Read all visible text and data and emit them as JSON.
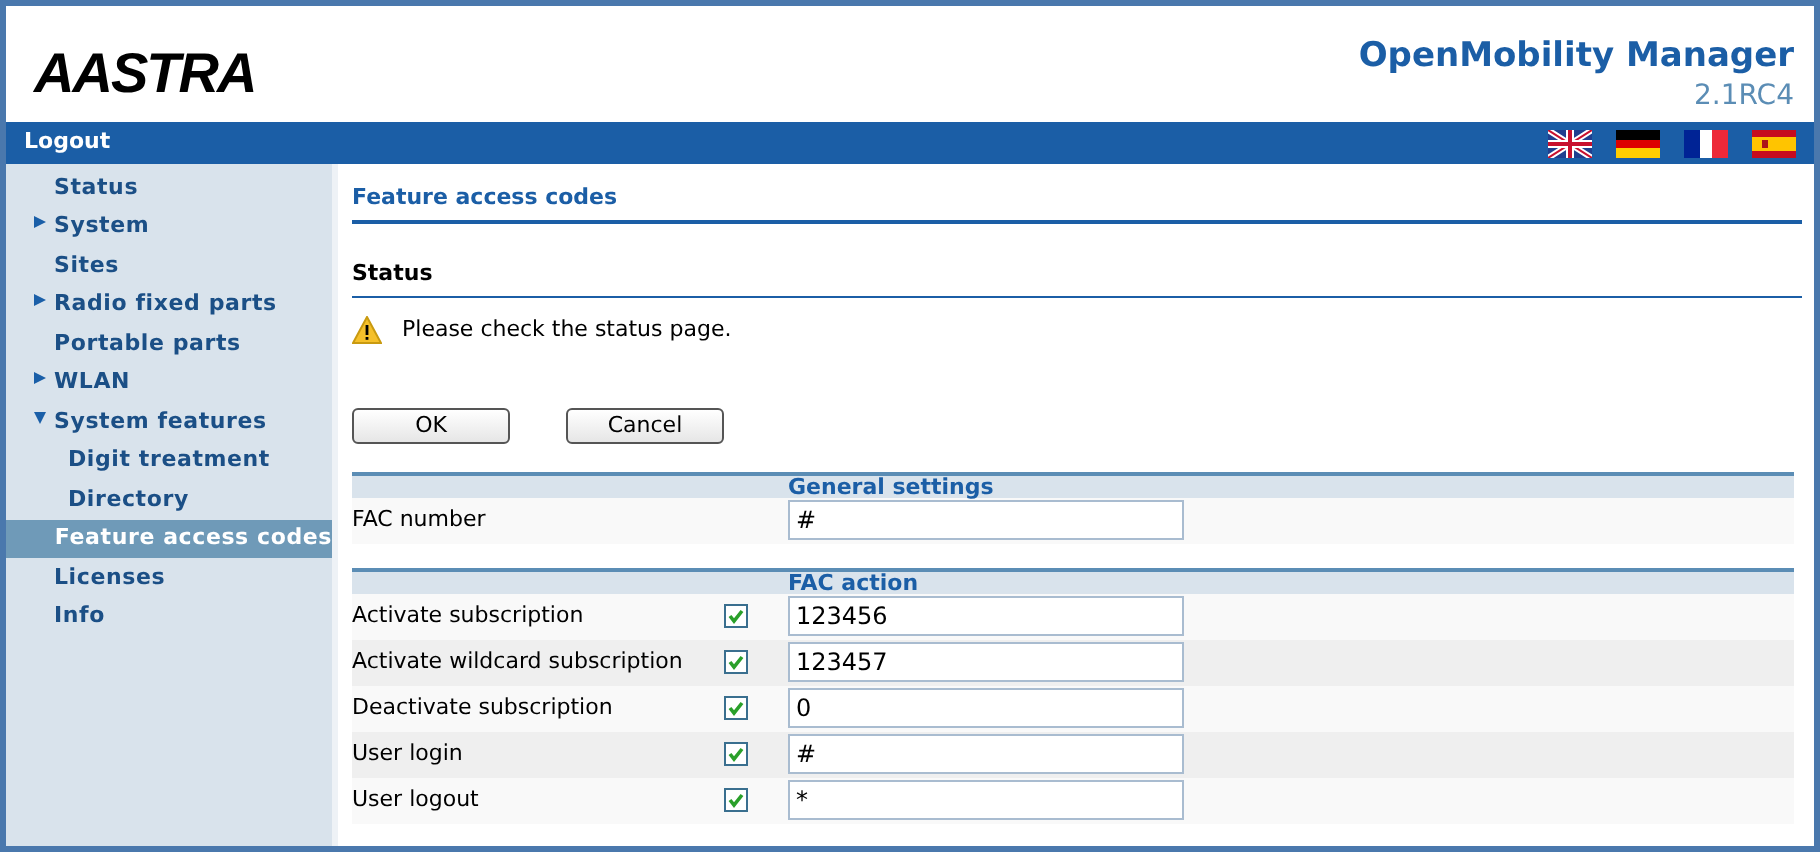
{
  "header": {
    "logo": "AASTRA",
    "product": "OpenMobility Manager",
    "version": "2.1RC4"
  },
  "menu_bar": {
    "logout": "Logout"
  },
  "sidebar": {
    "items": [
      {
        "label": "Status",
        "kind": "leaf",
        "selected": false
      },
      {
        "label": "System",
        "kind": "folder",
        "expanded": false,
        "selected": false
      },
      {
        "label": "Sites",
        "kind": "leaf",
        "selected": false
      },
      {
        "label": "Radio fixed parts",
        "kind": "folder",
        "expanded": false,
        "selected": false
      },
      {
        "label": "Portable parts",
        "kind": "leaf",
        "selected": false
      },
      {
        "label": "WLAN",
        "kind": "folder",
        "expanded": false,
        "selected": false
      },
      {
        "label": "System features",
        "kind": "folder",
        "expanded": true,
        "selected": false,
        "children": [
          {
            "label": "Digit treatment",
            "selected": false
          },
          {
            "label": "Directory",
            "selected": false
          },
          {
            "label": "Feature access codes",
            "selected": true
          }
        ]
      },
      {
        "label": "Licenses",
        "kind": "leaf",
        "selected": false
      },
      {
        "label": "Info",
        "kind": "leaf",
        "selected": false
      }
    ]
  },
  "page": {
    "title": "Feature access codes",
    "status_heading": "Status",
    "status_message": "Please check the status page.",
    "buttons": [
      "OK",
      "Cancel"
    ]
  },
  "general_settings": {
    "heading": "General settings",
    "rows": [
      {
        "label": "FAC number",
        "value": "#"
      }
    ]
  },
  "fac_action": {
    "heading": "FAC action",
    "rows": [
      {
        "label": "Activate subscription",
        "checked": true,
        "value": "123456"
      },
      {
        "label": "Activate wildcard subscription",
        "checked": true,
        "value": "123457"
      },
      {
        "label": "Deactivate subscription",
        "checked": true,
        "value": "0"
      },
      {
        "label": "User login",
        "checked": true,
        "value": "#"
      },
      {
        "label": "User logout",
        "checked": true,
        "value": "*"
      }
    ]
  }
}
